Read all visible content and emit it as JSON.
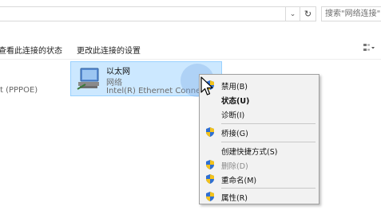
{
  "address_bar": {
    "dropdown_icon": "chevron-down-icon",
    "refresh_icon": "refresh-icon",
    "search_placeholder": "搜索\"网络连接\""
  },
  "command_bar": {
    "items": [
      "查看此连接的状态",
      "更改此连接的设置"
    ],
    "view_icon": "view-options-icon"
  },
  "connections": {
    "pppoe_label": "t (PPPOE)",
    "adapter": {
      "name": "以太网",
      "status": "网络",
      "device": "Intel(R) Ethernet Connection"
    }
  },
  "context_menu": {
    "items": [
      {
        "label": "禁用(B)",
        "shield": true,
        "bold": false,
        "disabled": false
      },
      {
        "label": "状态(U)",
        "shield": false,
        "bold": true,
        "disabled": false
      },
      {
        "label": "诊断(I)",
        "shield": false,
        "bold": false,
        "disabled": false
      },
      {
        "label": "桥接(G)",
        "shield": true,
        "bold": false,
        "disabled": false
      },
      {
        "label": "创建快捷方式(S)",
        "shield": false,
        "bold": false,
        "disabled": false
      },
      {
        "label": "删除(D)",
        "shield": true,
        "bold": false,
        "disabled": true
      },
      {
        "label": "重命名(M)",
        "shield": true,
        "bold": false,
        "disabled": false
      },
      {
        "label": "属性(R)",
        "shield": true,
        "bold": false,
        "disabled": false
      }
    ]
  },
  "colors": {
    "selection_fill": "#cce8ff",
    "selection_border": "#99d1ff",
    "menu_background": "#f2f2f2",
    "shield_blue": "#2f6fd1",
    "shield_yellow": "#f3c21b"
  }
}
